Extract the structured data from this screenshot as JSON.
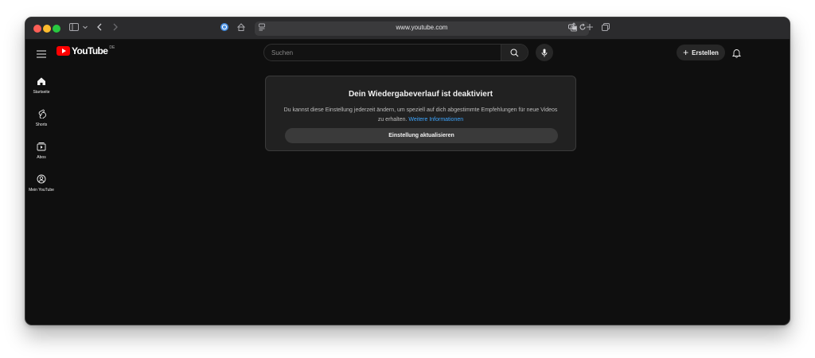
{
  "browser": {
    "url": "www.youtube.com"
  },
  "header": {
    "logo_text": "YouTube",
    "country_code": "DE",
    "search_placeholder": "Suchen",
    "create_label": "Erstellen"
  },
  "sidebar": {
    "items": [
      {
        "label": "Startseite",
        "icon": "home-icon"
      },
      {
        "label": "Shorts",
        "icon": "shorts-icon"
      },
      {
        "label": "Abos",
        "icon": "subscriptions-icon"
      },
      {
        "label": "Mein YouTube",
        "icon": "account-icon"
      }
    ]
  },
  "notice": {
    "title": "Dein Wiedergabeverlauf ist deaktiviert",
    "description": "Du kannst diese Einstellung jederzeit ändern, um speziell auf dich abgestimmte Empfehlungen für neue Videos zu erhalten.",
    "link_text": "Weitere Informationen",
    "button_label": "Einstellung aktualisieren"
  },
  "colors": {
    "background": "#0f0f0f",
    "card": "#212121",
    "link": "#3ea6ff",
    "brand_red": "#ff0000"
  }
}
